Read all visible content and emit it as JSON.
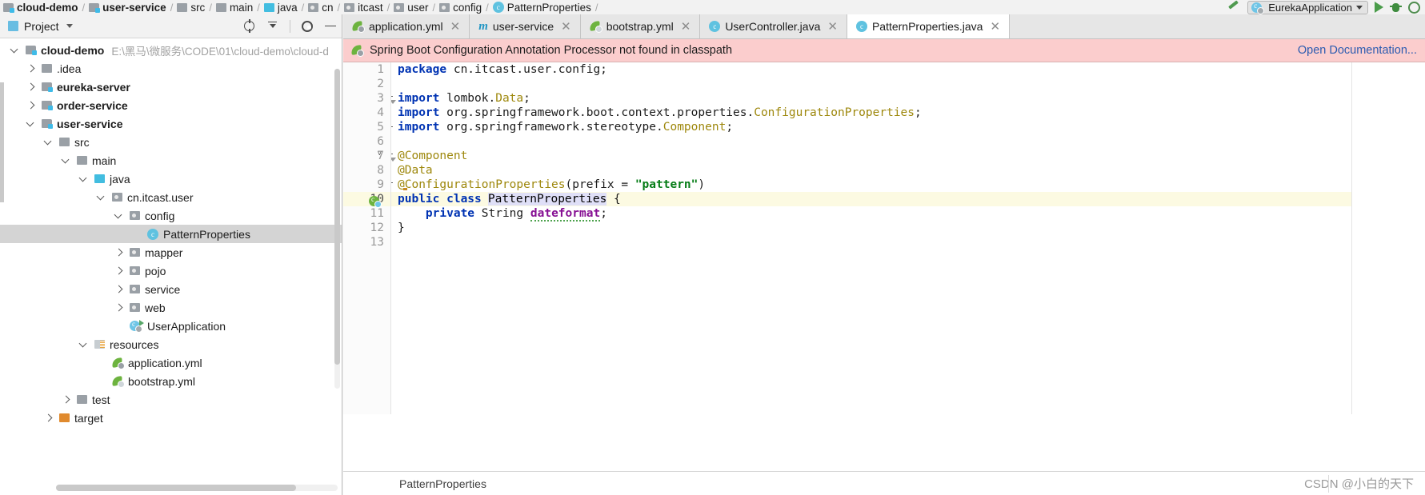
{
  "breadcrumb": {
    "items": [
      {
        "label": "cloud-demo",
        "icon": "module-icon",
        "bold": true
      },
      {
        "label": "user-service",
        "icon": "module-icon",
        "bold": true
      },
      {
        "label": "src",
        "icon": "folder-icon",
        "bold": false
      },
      {
        "label": "main",
        "icon": "folder-icon",
        "bold": false
      },
      {
        "label": "java",
        "icon": "source-folder-icon",
        "bold": false
      },
      {
        "label": "cn",
        "icon": "package-icon",
        "bold": false
      },
      {
        "label": "itcast",
        "icon": "package-icon",
        "bold": false
      },
      {
        "label": "user",
        "icon": "package-icon",
        "bold": false
      },
      {
        "label": "config",
        "icon": "package-icon",
        "bold": false
      },
      {
        "label": "PatternProperties",
        "icon": "class-icon",
        "bold": false
      }
    ]
  },
  "toolbar": {
    "run_configuration": "EurekaApplication",
    "build_icon": "build-hammer-icon",
    "run_icon": "run-play-icon",
    "debug_icon": "debug-bug-icon",
    "stop_icon": "stop-icon"
  },
  "project_panel": {
    "title": "Project",
    "actions": [
      {
        "name": "locate-file-icon"
      },
      {
        "name": "collapse-all-icon"
      },
      {
        "name": "settings-gear-icon"
      },
      {
        "name": "hide-panel-icon"
      }
    ],
    "tree": [
      {
        "label": "cloud-demo",
        "path": "E:\\黑马\\微服务\\CODE\\01\\cloud-demo\\cloud-d",
        "depth": 0,
        "arrow": "down",
        "icon": "module-icon",
        "bold": true,
        "selected": false
      },
      {
        "label": ".idea",
        "depth": 1,
        "arrow": "right",
        "icon": "folder-icon",
        "bold": false,
        "selected": false
      },
      {
        "label": "eureka-server",
        "depth": 1,
        "arrow": "right",
        "icon": "module-icon",
        "bold": true,
        "selected": false
      },
      {
        "label": "order-service",
        "depth": 1,
        "arrow": "right",
        "icon": "module-icon",
        "bold": true,
        "selected": false
      },
      {
        "label": "user-service",
        "depth": 1,
        "arrow": "down",
        "icon": "module-icon",
        "bold": true,
        "selected": false
      },
      {
        "label": "src",
        "depth": 2,
        "arrow": "down",
        "icon": "folder-icon",
        "bold": false,
        "selected": false
      },
      {
        "label": "main",
        "depth": 3,
        "arrow": "down",
        "icon": "folder-icon",
        "bold": false,
        "selected": false
      },
      {
        "label": "java",
        "depth": 4,
        "arrow": "down",
        "icon": "source-folder-icon",
        "bold": false,
        "selected": false
      },
      {
        "label": "cn.itcast.user",
        "depth": 5,
        "arrow": "down",
        "icon": "package-icon",
        "bold": false,
        "selected": false
      },
      {
        "label": "config",
        "depth": 6,
        "arrow": "down",
        "icon": "package-icon",
        "bold": false,
        "selected": false
      },
      {
        "label": "PatternProperties",
        "depth": 7,
        "arrow": "none",
        "icon": "class-icon",
        "bold": false,
        "selected": true
      },
      {
        "label": "mapper",
        "depth": 6,
        "arrow": "right",
        "icon": "package-icon",
        "bold": false,
        "selected": false
      },
      {
        "label": "pojo",
        "depth": 6,
        "arrow": "right",
        "icon": "package-icon",
        "bold": false,
        "selected": false
      },
      {
        "label": "service",
        "depth": 6,
        "arrow": "right",
        "icon": "package-icon",
        "bold": false,
        "selected": false
      },
      {
        "label": "web",
        "depth": 6,
        "arrow": "right",
        "icon": "package-icon",
        "bold": false,
        "selected": false
      },
      {
        "label": "UserApplication",
        "depth": 6,
        "arrow": "none",
        "icon": "spring-boot-app-icon",
        "bold": false,
        "selected": false
      },
      {
        "label": "resources",
        "depth": 4,
        "arrow": "down",
        "icon": "resources-folder-icon",
        "bold": false,
        "selected": false
      },
      {
        "label": "application.yml",
        "depth": 5,
        "arrow": "none",
        "icon": "spring-yml-icon",
        "bold": false,
        "selected": false
      },
      {
        "label": "bootstrap.yml",
        "depth": 5,
        "arrow": "none",
        "icon": "spring-cloud-yml-icon",
        "bold": false,
        "selected": false
      },
      {
        "label": "test",
        "depth": 3,
        "arrow": "right",
        "icon": "folder-icon",
        "bold": false,
        "selected": false
      },
      {
        "label": "target",
        "depth": 2,
        "arrow": "right",
        "icon": "target-folder-icon",
        "bold": false,
        "selected": false
      }
    ]
  },
  "editor": {
    "tabs": [
      {
        "label": "application.yml",
        "icon": "spring-yml-icon",
        "active": false
      },
      {
        "label": "user-service",
        "icon": "maven-icon",
        "active": false
      },
      {
        "label": "bootstrap.yml",
        "icon": "spring-cloud-yml-icon",
        "active": false
      },
      {
        "label": "UserController.java",
        "icon": "java-class-icon",
        "active": false
      },
      {
        "label": "PatternProperties.java",
        "icon": "java-class-icon",
        "active": true
      }
    ],
    "banner": {
      "icon": "spring-leaf-icon",
      "message": "Spring Boot Configuration Annotation Processor not found in classpath",
      "link": "Open Documentation..."
    },
    "line_numbers": [
      "1",
      "2",
      "3",
      "4",
      "5",
      "6",
      "7",
      "8",
      "9",
      "10",
      "11",
      "12",
      "13"
    ],
    "caret_line": 10,
    "code_lines": [
      {
        "n": 1,
        "tokens": [
          {
            "t": "package ",
            "c": "kw"
          },
          {
            "t": "cn.itcast.user.config;",
            "c": "plain"
          }
        ]
      },
      {
        "n": 2,
        "tokens": []
      },
      {
        "n": 3,
        "tokens": [
          {
            "t": "import ",
            "c": "kw"
          },
          {
            "t": "lombok.",
            "c": "plain"
          },
          {
            "t": "Data",
            "c": "type"
          },
          {
            "t": ";",
            "c": "plain"
          }
        ]
      },
      {
        "n": 4,
        "tokens": [
          {
            "t": "import ",
            "c": "kw"
          },
          {
            "t": "org.springframework.boot.context.properties.",
            "c": "plain"
          },
          {
            "t": "ConfigurationProperties",
            "c": "type"
          },
          {
            "t": ";",
            "c": "plain"
          }
        ]
      },
      {
        "n": 5,
        "tokens": [
          {
            "t": "import ",
            "c": "kw"
          },
          {
            "t": "org.springframework.stereotype.",
            "c": "plain"
          },
          {
            "t": "Component",
            "c": "type"
          },
          {
            "t": ";",
            "c": "plain"
          }
        ]
      },
      {
        "n": 6,
        "tokens": []
      },
      {
        "n": 7,
        "tokens": [
          {
            "t": "@Component",
            "c": "ann"
          }
        ]
      },
      {
        "n": 8,
        "tokens": [
          {
            "t": "@Data",
            "c": "ann"
          }
        ]
      },
      {
        "n": 9,
        "tokens": [
          {
            "t": "@ConfigurationProperties",
            "c": "ann"
          },
          {
            "t": "(prefix = ",
            "c": "plain"
          },
          {
            "t": "\"pattern\"",
            "c": "str"
          },
          {
            "t": ")",
            "c": "plain"
          }
        ]
      },
      {
        "n": 10,
        "tokens": [
          {
            "t": "public class ",
            "c": "kw"
          },
          {
            "t": "|",
            "c": "caret"
          },
          {
            "t": "PatternProperties",
            "c": "classname"
          },
          {
            "t": " {",
            "c": "plain"
          }
        ]
      },
      {
        "n": 11,
        "tokens": [
          {
            "t": "    private ",
            "c": "kw"
          },
          {
            "t": "String ",
            "c": "plain"
          },
          {
            "t": "dateformat",
            "c": "fld"
          },
          {
            "t": ";",
            "c": "plain"
          }
        ]
      },
      {
        "n": 12,
        "tokens": [
          {
            "t": "}",
            "c": "plain"
          }
        ]
      },
      {
        "n": 13,
        "tokens": []
      }
    ]
  },
  "statusbar": {
    "breadcrumb": "PatternProperties",
    "watermark": "CSDN @小白的天下"
  }
}
